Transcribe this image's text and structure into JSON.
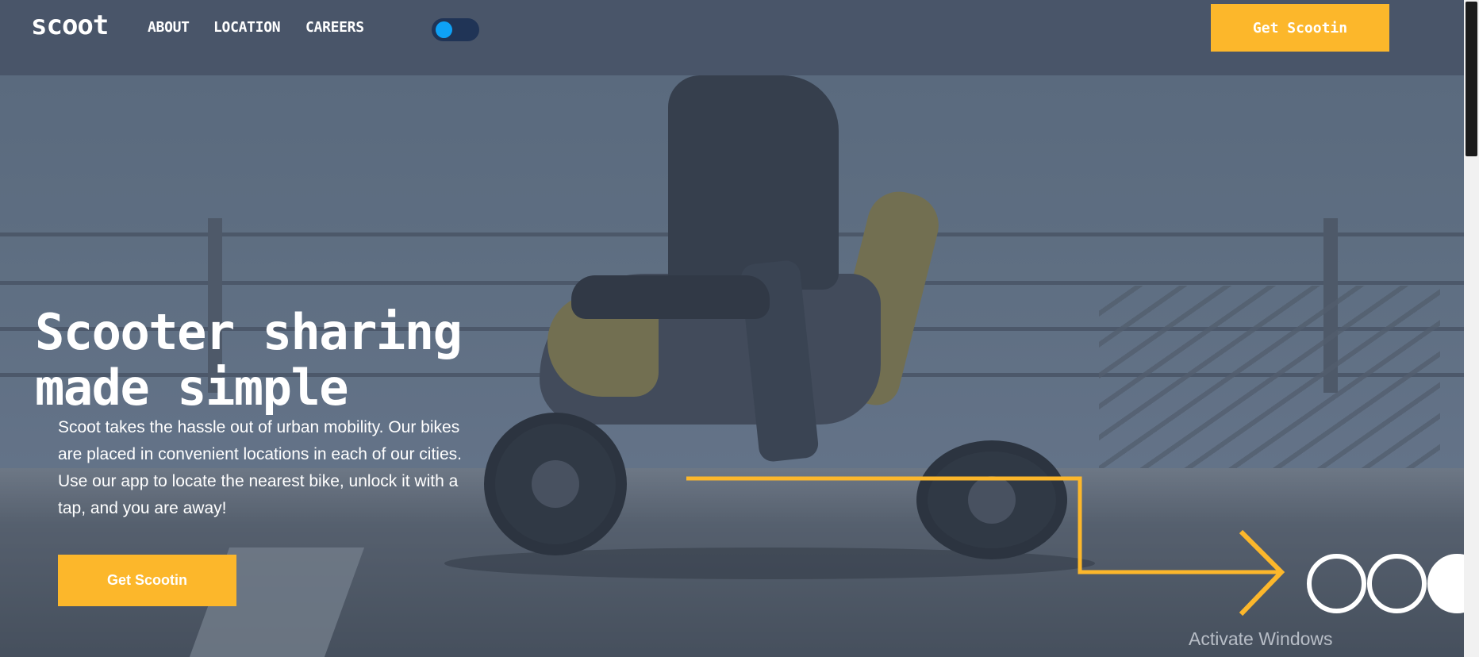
{
  "brand": {
    "logo": "scoot"
  },
  "nav": {
    "links": [
      "ABOUT",
      "LOCATION",
      "CAREERS"
    ],
    "theme_toggle": {
      "state": "on"
    },
    "cta_label": "Get Scootin"
  },
  "hero": {
    "headline_line1": "Scooter sharing",
    "headline_line2": "made simple",
    "intro": "Scoot takes the hassle out of urban mobility. Our bikes are placed in convenient locations in each of our cities. Use our app to locate the nearest bike, unlock it with a tap, and you are away!",
    "cta_label": "Get Scootin"
  },
  "os_watermark": "Activate Windows",
  "colors": {
    "accent": "#fcb72b",
    "navbar": "#495569",
    "toggle_track": "#203456",
    "toggle_knob": "#0ea1f6",
    "text": "#ffffff"
  },
  "icons": [
    "arrow-right-icon",
    "circle-outline-icon",
    "circle-filled-icon"
  ]
}
